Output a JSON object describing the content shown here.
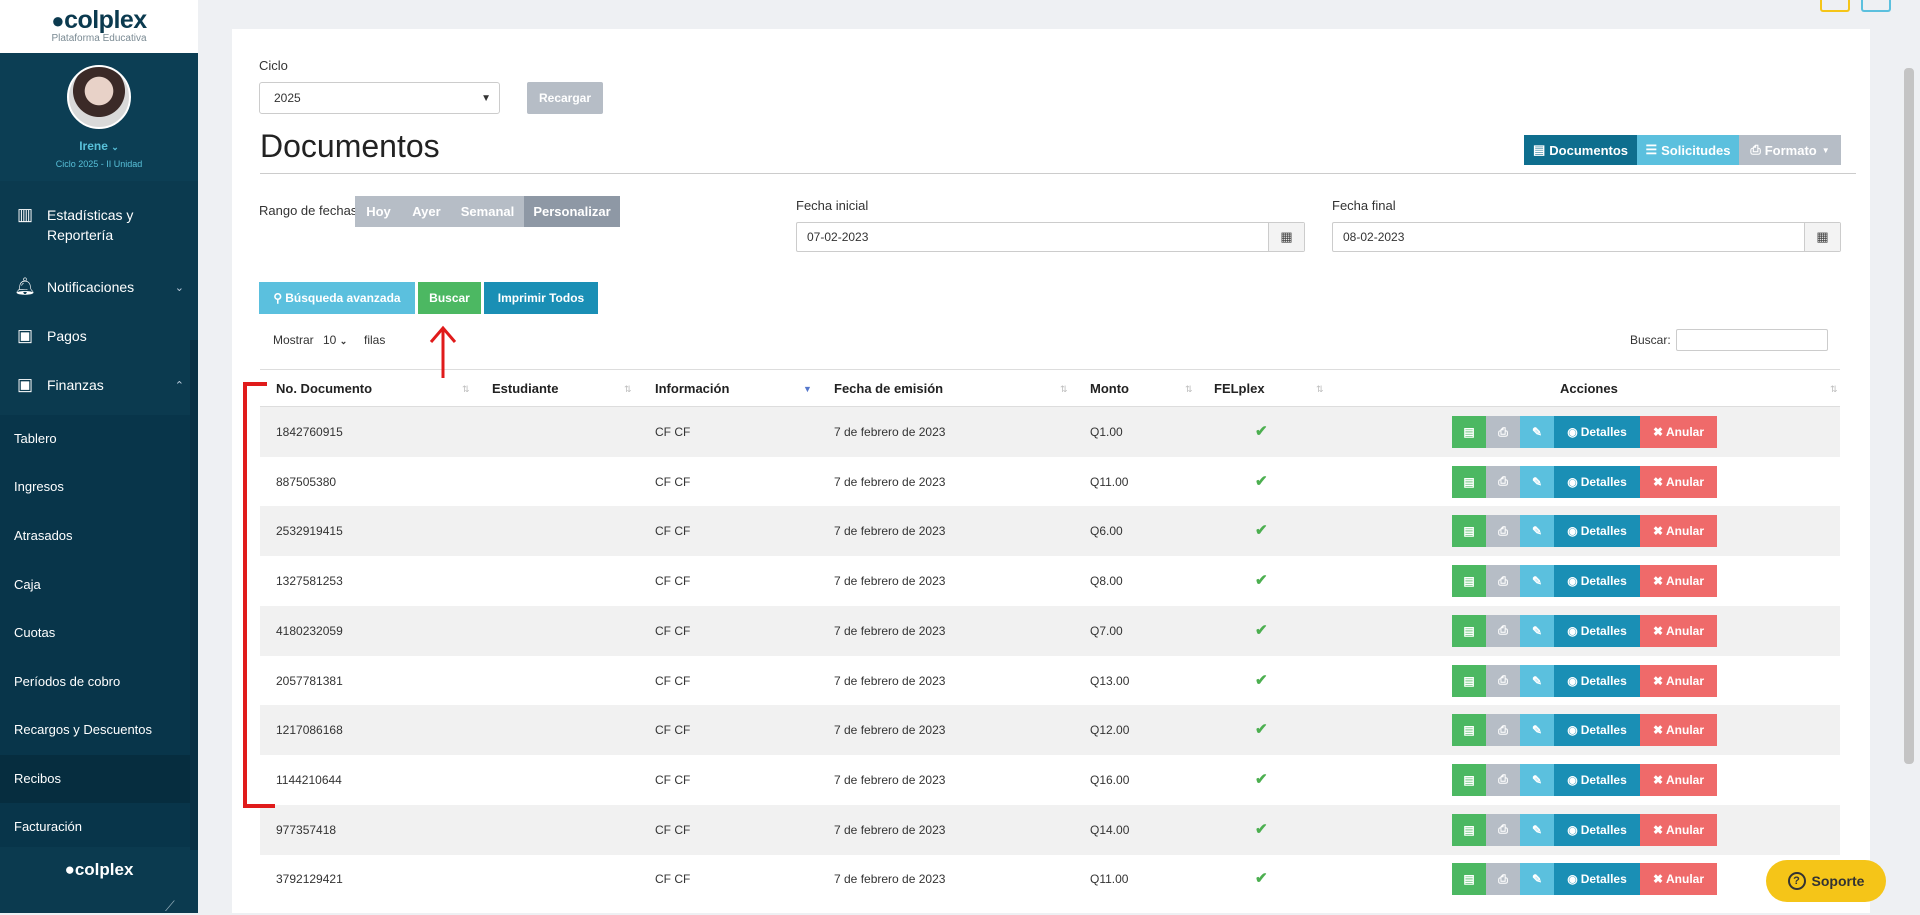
{
  "sidebar": {
    "logo": "colplex",
    "logo_sub": "Plataforma Educativa",
    "user_name": "Irene",
    "user_cycle": "Ciclo 2025 - II Unidad",
    "menu": [
      {
        "label": "Estadísticas y Reportería",
        "icon": "bar-chart-icon"
      },
      {
        "label": "Notificaciones",
        "icon": "bell-icon"
      },
      {
        "label": "Pagos",
        "icon": "money-icon"
      },
      {
        "label": "Finanzas",
        "icon": "money-icon"
      }
    ],
    "submenu": [
      "Tablero",
      "Ingresos",
      "Atrasados",
      "Caja",
      "Cuotas",
      "Períodos de cobro",
      "Recargos y Descuentos",
      "Recibos",
      "Facturación"
    ],
    "active_submenu": "Recibos",
    "footer_logo": "colplex"
  },
  "filters": {
    "ciclo_label": "Ciclo",
    "ciclo_value": "2025",
    "recargar": "Recargar",
    "rango_label": "Rango de fechas",
    "rango_options": [
      "Hoy",
      "Ayer",
      "Semanal",
      "Personalizar"
    ],
    "fecha_inicial_label": "Fecha inicial",
    "fecha_inicial": "07-02-2023",
    "fecha_final_label": "Fecha final",
    "fecha_final": "08-02-2023"
  },
  "page_title": "Documentos",
  "view_buttons": {
    "documentos": "Documentos",
    "solicitudes": "Solicitudes",
    "formato": "Formato"
  },
  "actions": {
    "busqueda": "Búsqueda avanzada",
    "buscar": "Buscar",
    "imprimir": "Imprimir Todos"
  },
  "table_ctrl": {
    "mostrar": "Mostrar",
    "page_size": "10",
    "filas": "filas",
    "buscar": "Buscar:"
  },
  "columns": [
    "No. Documento",
    "Estudiante",
    "Información",
    "Fecha de emisión",
    "Monto",
    "FELplex",
    "Acciones"
  ],
  "rows": [
    {
      "doc": "1842760915",
      "estudiante": "",
      "info": "CF CF",
      "fecha": "7 de febrero de 2023",
      "monto": "Q1.00"
    },
    {
      "doc": "887505380",
      "estudiante": "",
      "info": "CF CF",
      "fecha": "7 de febrero de 2023",
      "monto": "Q11.00"
    },
    {
      "doc": "2532919415",
      "estudiante": "",
      "info": "CF CF",
      "fecha": "7 de febrero de 2023",
      "monto": "Q6.00"
    },
    {
      "doc": "1327581253",
      "estudiante": "",
      "info": "CF CF",
      "fecha": "7 de febrero de 2023",
      "monto": "Q8.00"
    },
    {
      "doc": "4180232059",
      "estudiante": "",
      "info": "CF CF",
      "fecha": "7 de febrero de 2023",
      "monto": "Q7.00"
    },
    {
      "doc": "2057781381",
      "estudiante": "",
      "info": "CF CF",
      "fecha": "7 de febrero de 2023",
      "monto": "Q13.00"
    },
    {
      "doc": "1217086168",
      "estudiante": "",
      "info": "CF CF",
      "fecha": "7 de febrero de 2023",
      "monto": "Q12.00"
    },
    {
      "doc": "1144210644",
      "estudiante": "",
      "info": "CF CF",
      "fecha": "7 de febrero de 2023",
      "monto": "Q16.00"
    },
    {
      "doc": "977357418",
      "estudiante": "",
      "info": "CF CF",
      "fecha": "7 de febrero de 2023",
      "monto": "Q14.00"
    },
    {
      "doc": "3792129421",
      "estudiante": "",
      "info": "CF CF",
      "fecha": "7 de febrero de 2023",
      "monto": "Q11.00"
    }
  ],
  "row_actions": {
    "detalles": "Detalles",
    "anular": "Anular"
  },
  "support": "Soporte",
  "colors": {
    "sidebar": "#0b3a4f",
    "accent": "#58c0d9",
    "green": "#4cb862",
    "red": "#ef6a6a",
    "blue": "#1a8fb5",
    "annotation": "#e01b1b"
  }
}
